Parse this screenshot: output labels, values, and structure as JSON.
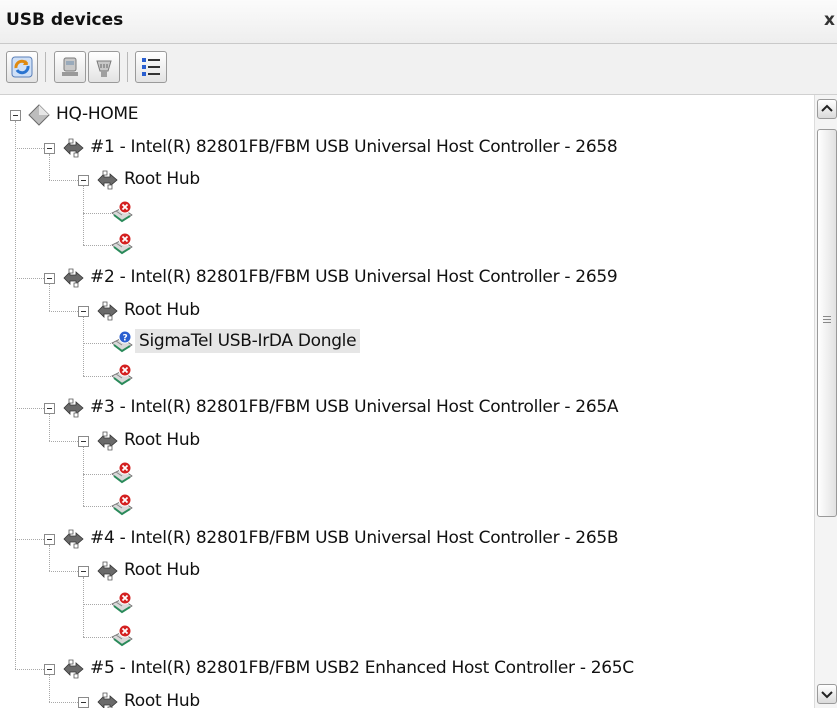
{
  "window": {
    "title": "USB devices",
    "close_glyph": "x"
  },
  "toolbar": {
    "buttons": [
      {
        "icon": "refresh-icon"
      },
      {
        "icon": "device-view-icon"
      },
      {
        "icon": "connector-view-icon"
      },
      {
        "icon": "details-list-icon"
      }
    ]
  },
  "tree": {
    "root": "HQ-HOME",
    "controllers": [
      {
        "label": "#1 - Intel(R) 82801FB/FBM USB Universal Host Controller - 2658",
        "hub": "Root Hub",
        "ports": [
          {
            "label": "",
            "status": "error"
          },
          {
            "label": "",
            "status": "error"
          }
        ]
      },
      {
        "label": "#2 - Intel(R) 82801FB/FBM USB Universal Host Controller - 2659",
        "hub": "Root Hub",
        "ports": [
          {
            "label": "SigmaTel USB-IrDA Dongle",
            "status": "unknown",
            "selected": true
          },
          {
            "label": "",
            "status": "error"
          }
        ]
      },
      {
        "label": "#3 - Intel(R) 82801FB/FBM USB Universal Host Controller - 265A",
        "hub": "Root Hub",
        "ports": [
          {
            "label": "",
            "status": "error"
          },
          {
            "label": "",
            "status": "error"
          }
        ]
      },
      {
        "label": "#4 - Intel(R) 82801FB/FBM USB Universal Host Controller - 265B",
        "hub": "Root Hub",
        "ports": [
          {
            "label": "",
            "status": "error"
          },
          {
            "label": "",
            "status": "error"
          }
        ]
      },
      {
        "label": "#5 - Intel(R) 82801FB/FBM USB2 Enhanced Host Controller - 265C",
        "hub": "Root Hub",
        "ports": []
      }
    ]
  },
  "colors": {
    "error_badge": "#d42020",
    "unknown_badge": "#2a5fd0",
    "root_diamond": "#8a8a8a"
  }
}
